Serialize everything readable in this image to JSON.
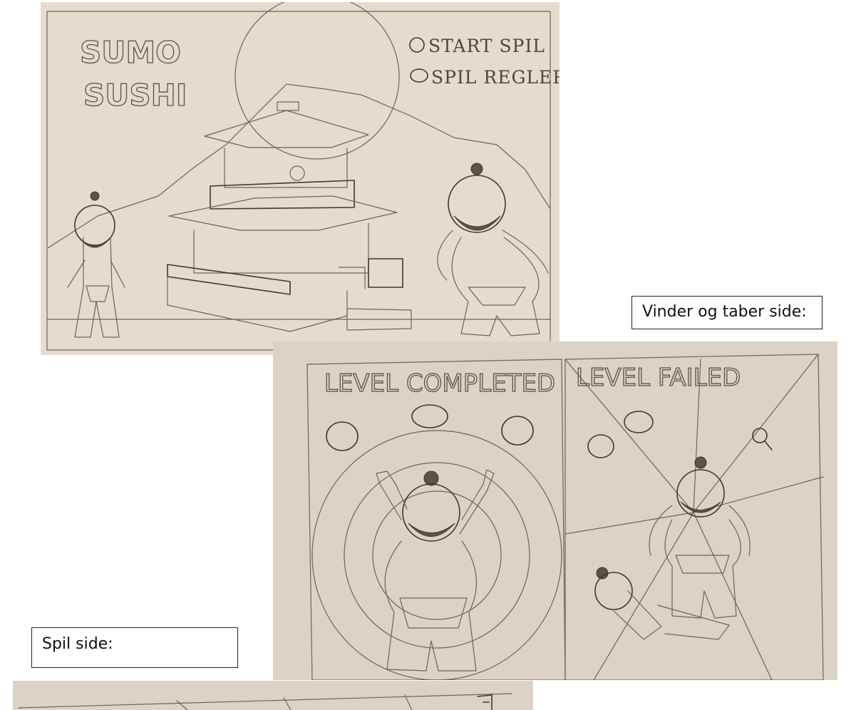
{
  "title_screen": {
    "logo_line1": "SUMO",
    "logo_line2": "SUSHI",
    "menu": {
      "start": "START SPIL",
      "rules": "SPIL REGLER"
    }
  },
  "captions": {
    "winner_loser": "Vinder og taber side:",
    "game": "Spil side:"
  },
  "result_screens": {
    "completed": "LEVEL COMPLETED",
    "failed": "LEVEL FAILED"
  },
  "colors": {
    "paper": "#e6dbcf",
    "pencil": "#5a534c"
  }
}
